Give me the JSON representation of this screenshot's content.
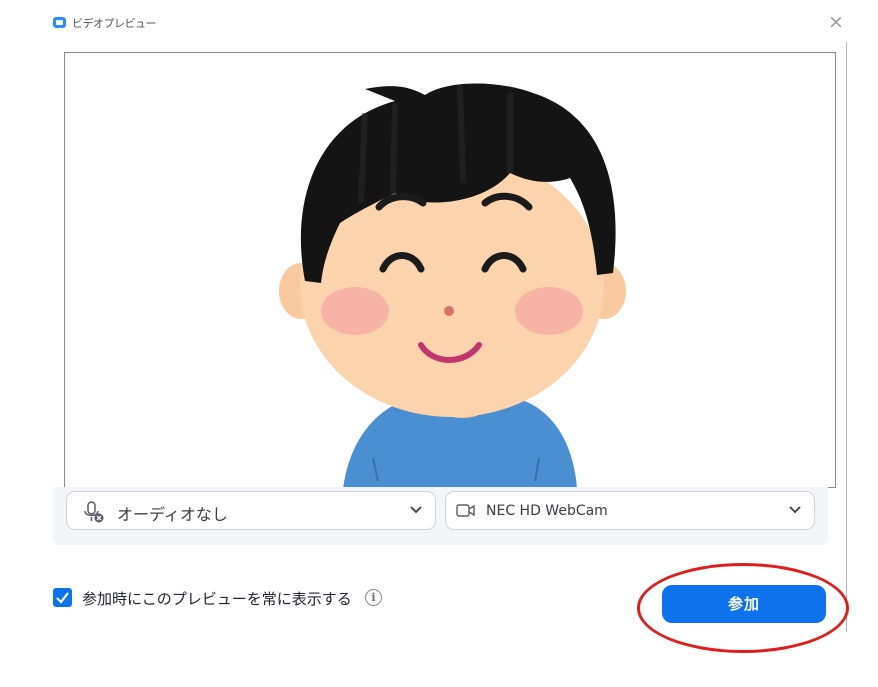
{
  "window": {
    "title": "ビデオプレビュー",
    "close_glyph": "×"
  },
  "preview": {
    "content": "person-illustration"
  },
  "audio_select": {
    "label": "オーディオなし",
    "icon": "microphone-muted-icon"
  },
  "video_select": {
    "label": "NEC HD WebCam",
    "icon": "camera-icon"
  },
  "checkbox": {
    "label": "参加時にこのプレビューを常に表示する",
    "checked": true
  },
  "join_button": {
    "label": "参加"
  },
  "colors": {
    "accent": "#0e72ed",
    "annotation": "#e01c1c"
  }
}
